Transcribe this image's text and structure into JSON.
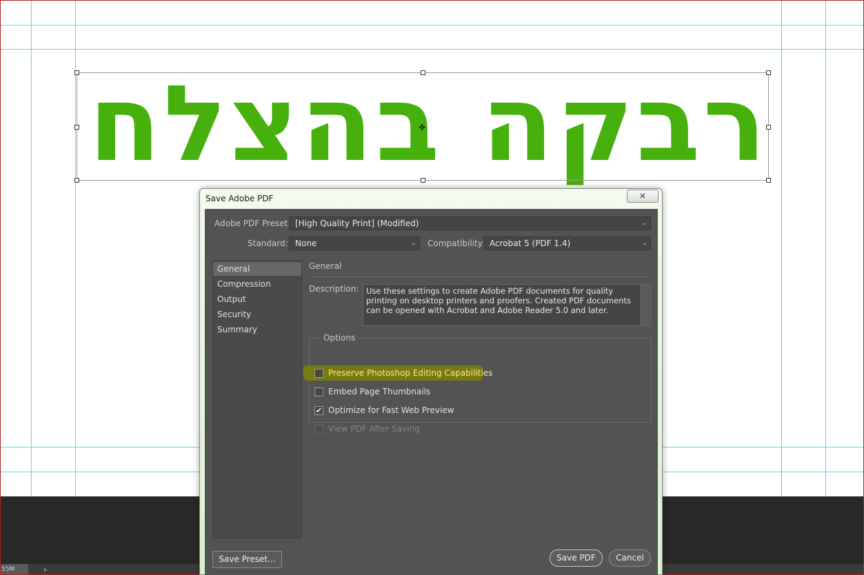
{
  "canvas": {
    "headline_text": "רבקה בהצלחה",
    "zoom": "55M",
    "status_arrow": "›",
    "center_glyph": "✥"
  },
  "dialog": {
    "title": "Save Adobe PDF",
    "close_glyph": "⨯",
    "preset_label": "Adobe PDF Preset:",
    "preset_value": "[High Quality Print] (Modified)",
    "standard_label": "Standard:",
    "standard_value": "None",
    "compat_label": "Compatibility:",
    "compat_value": "Acrobat 5 (PDF 1.4)",
    "nav": [
      {
        "label": "General",
        "active": true
      },
      {
        "label": "Compression",
        "active": false
      },
      {
        "label": "Output",
        "active": false
      },
      {
        "label": "Security",
        "active": false
      },
      {
        "label": "Summary",
        "active": false
      }
    ],
    "section_title": "General",
    "description_label": "Description:",
    "description": "Use these settings to create Adobe PDF documents for quality printing on desktop printers and proofers.  Created PDF documents can be opened with Acrobat and Adobe Reader 5.0 and later.",
    "options_legend": "Options",
    "options": [
      {
        "label": "Preserve Photoshop Editing Capabilities",
        "checked": false,
        "disabled": false
      },
      {
        "label": "Embed Page Thumbnails",
        "checked": false,
        "disabled": false
      },
      {
        "label": "Optimize for Fast Web Preview",
        "checked": true,
        "disabled": false
      },
      {
        "label": "View PDF After Saving",
        "checked": false,
        "disabled": true
      }
    ],
    "save_preset_label": "Save Preset...",
    "save_pdf_label": "Save PDF",
    "cancel_label": "Cancel",
    "check_glyph": "✔",
    "chevron_glyph": "⌄"
  },
  "colors": {
    "headline_green": "#46b00c",
    "guide_cyan": "#5fd6e6",
    "dialog_bg": "#535353",
    "highlight": "#808008"
  }
}
